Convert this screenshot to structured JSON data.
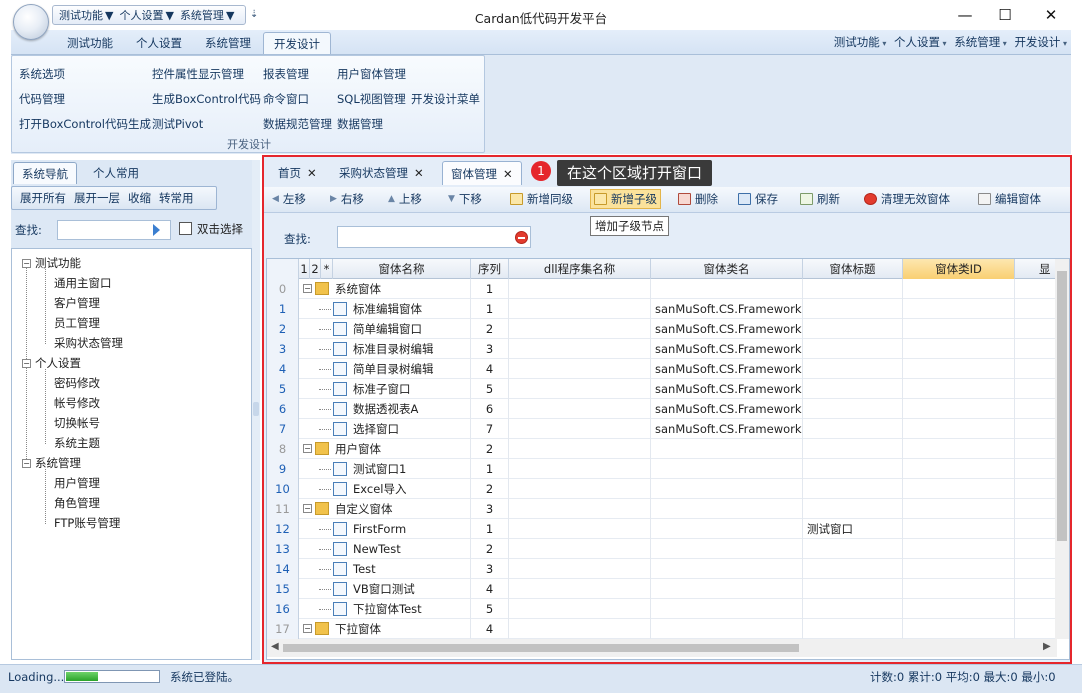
{
  "window": {
    "title": "Cardan低代码开发平台",
    "minimize": "—",
    "maximize": "☐",
    "close": "✕"
  },
  "quick_access": {
    "items": [
      "测试功能",
      "个人设置",
      "系统管理"
    ],
    "extra": "⇣"
  },
  "ribbon": {
    "tabs": [
      "测试功能",
      "个人设置",
      "系统管理",
      "开发设计"
    ],
    "active_tab": "开发设计",
    "right_menus": [
      "测试功能",
      "个人设置",
      "系统管理",
      "开发设计"
    ],
    "group_label": "开发设计",
    "items": [
      [
        "系统选项",
        "代码管理",
        "打开BoxControl代码生成"
      ],
      [
        "控件属性显示管理",
        "生成BoxControl代码",
        "测试Pivot"
      ],
      [
        "报表管理",
        "命令窗口",
        "数据规范管理"
      ],
      [
        "用户窗体管理",
        "SQL视图管理",
        "数据管理"
      ],
      [
        "开发设计菜单"
      ]
    ]
  },
  "nav": {
    "tabs": [
      "系统导航",
      "个人常用"
    ],
    "active_tab": "系统导航",
    "toolbar": [
      "展开所有",
      "展开一层",
      "收缩",
      "转常用"
    ],
    "search_label": "查找:",
    "double_click_label": "双击选择",
    "tree": [
      {
        "label": "测试功能",
        "children": [
          "通用主窗口",
          "客户管理",
          "员工管理",
          "采购状态管理"
        ]
      },
      {
        "label": "个人设置",
        "children": [
          "密码修改",
          "帐号修改",
          "切换帐号",
          "系统主题"
        ]
      },
      {
        "label": "系统管理",
        "children": [
          "用户管理",
          "角色管理",
          "FTP账号管理"
        ]
      }
    ]
  },
  "doc_tabs": [
    "首页",
    "采购状态管理",
    "窗体管理"
  ],
  "active_doc_tab": "窗体管理",
  "callout": {
    "number": "1",
    "text": "在这个区域打开窗口"
  },
  "toolbar": {
    "buttons": [
      "左移",
      "右移",
      "上移",
      "下移",
      "新增同级",
      "新增子级",
      "删除",
      "保存",
      "刷新",
      "清理无效窗体",
      "编辑窗体"
    ],
    "tooltip": "增加子级节点"
  },
  "filter": {
    "label": "查找:",
    "value": ""
  },
  "grid": {
    "headers": [
      "1",
      "2",
      "*",
      "窗体名称",
      "序列",
      "dll程序集名称",
      "窗体类名",
      "窗体标题",
      "窗体类ID",
      "显"
    ],
    "rows": [
      {
        "no": "0",
        "name": "系统窗体",
        "seq": "1",
        "dll": "",
        "cls": "",
        "title": "",
        "level": 0,
        "icon": "folder"
      },
      {
        "no": "1",
        "name": "标准编辑窗体",
        "seq": "1",
        "dll": "",
        "cls": "sanMuSoft.CS.Framework",
        "title": "",
        "level": 1,
        "icon": "form"
      },
      {
        "no": "2",
        "name": "简单编辑窗口",
        "seq": "2",
        "dll": "",
        "cls": "sanMuSoft.CS.Framework",
        "title": "",
        "level": 1,
        "icon": "form"
      },
      {
        "no": "3",
        "name": "标准目录树编辑",
        "seq": "3",
        "dll": "",
        "cls": "sanMuSoft.CS.Framework",
        "title": "",
        "level": 1,
        "icon": "form"
      },
      {
        "no": "4",
        "name": "简单目录树编辑",
        "seq": "4",
        "dll": "",
        "cls": "sanMuSoft.CS.Framework",
        "title": "",
        "level": 1,
        "icon": "form"
      },
      {
        "no": "5",
        "name": "标准子窗口",
        "seq": "5",
        "dll": "",
        "cls": "sanMuSoft.CS.Framework",
        "title": "",
        "level": 1,
        "icon": "form"
      },
      {
        "no": "6",
        "name": "数据透视表A",
        "seq": "6",
        "dll": "",
        "cls": "sanMuSoft.CS.Framework",
        "title": "",
        "level": 1,
        "icon": "form"
      },
      {
        "no": "7",
        "name": "选择窗口",
        "seq": "7",
        "dll": "",
        "cls": "sanMuSoft.CS.Framework",
        "title": "",
        "level": 1,
        "icon": "form"
      },
      {
        "no": "8",
        "name": "用户窗体",
        "seq": "2",
        "dll": "",
        "cls": "",
        "title": "",
        "level": 0,
        "icon": "folder"
      },
      {
        "no": "9",
        "name": "测试窗口1",
        "seq": "1",
        "dll": "",
        "cls": "",
        "title": "",
        "level": 1,
        "icon": "form"
      },
      {
        "no": "10",
        "name": "Excel导入",
        "seq": "2",
        "dll": "",
        "cls": "",
        "title": "",
        "level": 1,
        "icon": "form"
      },
      {
        "no": "11",
        "name": "自定义窗体",
        "seq": "3",
        "dll": "",
        "cls": "",
        "title": "",
        "level": 0,
        "icon": "folder"
      },
      {
        "no": "12",
        "name": "FirstForm",
        "seq": "1",
        "dll": "",
        "cls": "",
        "title": "测试窗口",
        "level": 1,
        "icon": "form"
      },
      {
        "no": "13",
        "name": "NewTest",
        "seq": "2",
        "dll": "",
        "cls": "",
        "title": "",
        "level": 1,
        "icon": "form"
      },
      {
        "no": "14",
        "name": "Test",
        "seq": "3",
        "dll": "",
        "cls": "",
        "title": "",
        "level": 1,
        "icon": "form"
      },
      {
        "no": "15",
        "name": "VB窗口测试",
        "seq": "4",
        "dll": "",
        "cls": "",
        "title": "",
        "level": 1,
        "icon": "form"
      },
      {
        "no": "16",
        "name": "下拉窗体Test",
        "seq": "5",
        "dll": "",
        "cls": "",
        "title": "",
        "level": 1,
        "icon": "form"
      },
      {
        "no": "17",
        "name": "下拉窗体",
        "seq": "4",
        "dll": "",
        "cls": "",
        "title": "",
        "level": 0,
        "icon": "folder"
      }
    ]
  },
  "status": {
    "loading": "Loading...",
    "progress": 0.35,
    "message": "系统已登陆。",
    "stats": "计数:0 累计:0 平均:0 最大:0 最小:0"
  }
}
